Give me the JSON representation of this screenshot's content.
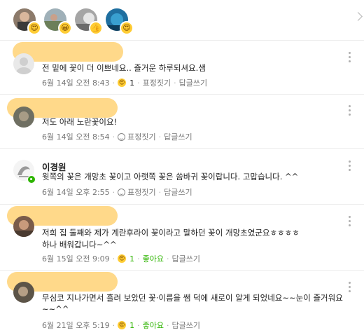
{
  "reactions": {
    "avatars": [
      {
        "name": "reactor-avatar-1",
        "emoji": "heart-eyes-emoji",
        "emoji_glyph": "😍"
      },
      {
        "name": "reactor-avatar-2",
        "emoji": "grin-emoji",
        "emoji_glyph": "😀"
      },
      {
        "name": "reactor-avatar-3",
        "emoji": "thumbs-emoji",
        "emoji_glyph": "👍"
      },
      {
        "name": "reactor-avatar-4",
        "emoji": "heart-eyes-emoji",
        "emoji_glyph": "😍"
      }
    ]
  },
  "comments": [
    {
      "text": "전 밑에 꽃이 더 이쁘네요.. 즐거운 하루되셔요.샘",
      "date": "6월 14일 오전 8:43",
      "reaction_count": "1",
      "react_label": "표정짓기",
      "reply_label": "답글쓰기"
    },
    {
      "text": "저도 아래 노란꽃이요!",
      "date": "6월 14일 오전 8:54",
      "react_label": "표정짓기",
      "reply_label": "답글쓰기"
    },
    {
      "author": "이경원",
      "text": "윗쪽의 꽃은 개망초 꽃이고 아랫쪽 꽃은 씀바귀 꽃이랍니다. 고맙습니다. ^^",
      "date": "6월 14일 오후 2:55",
      "react_label": "표정짓기",
      "reply_label": "답글쓰기"
    },
    {
      "text_line1": "저희 집 둘째와 제가 계란후라이 꽃이라고 말하던 꽃이 개망초였군요ㅎㅎㅎㅎ",
      "text_line2": "하나 배워갑니다~^^",
      "date": "6월 15일 오전 9:09",
      "reaction_count": "1",
      "like_label": "좋아요",
      "reply_label": "답글쓰기"
    },
    {
      "text_line1": "무심코  지나가면서 흘려 보았던 꽃·이름을 쌤 덕에 새로이 알게 되었네요~~눈이 즐거워요",
      "text_line2": "~~^^",
      "date": "6월 21일 오후 5:19",
      "reaction_count": "1",
      "like_label": "좋아요",
      "reply_label": "답글쓰기"
    }
  ],
  "separator": "·",
  "colors": {
    "accent": "#2db400",
    "name_mask": "#ffd98a",
    "reaction": "#ffcc33"
  }
}
